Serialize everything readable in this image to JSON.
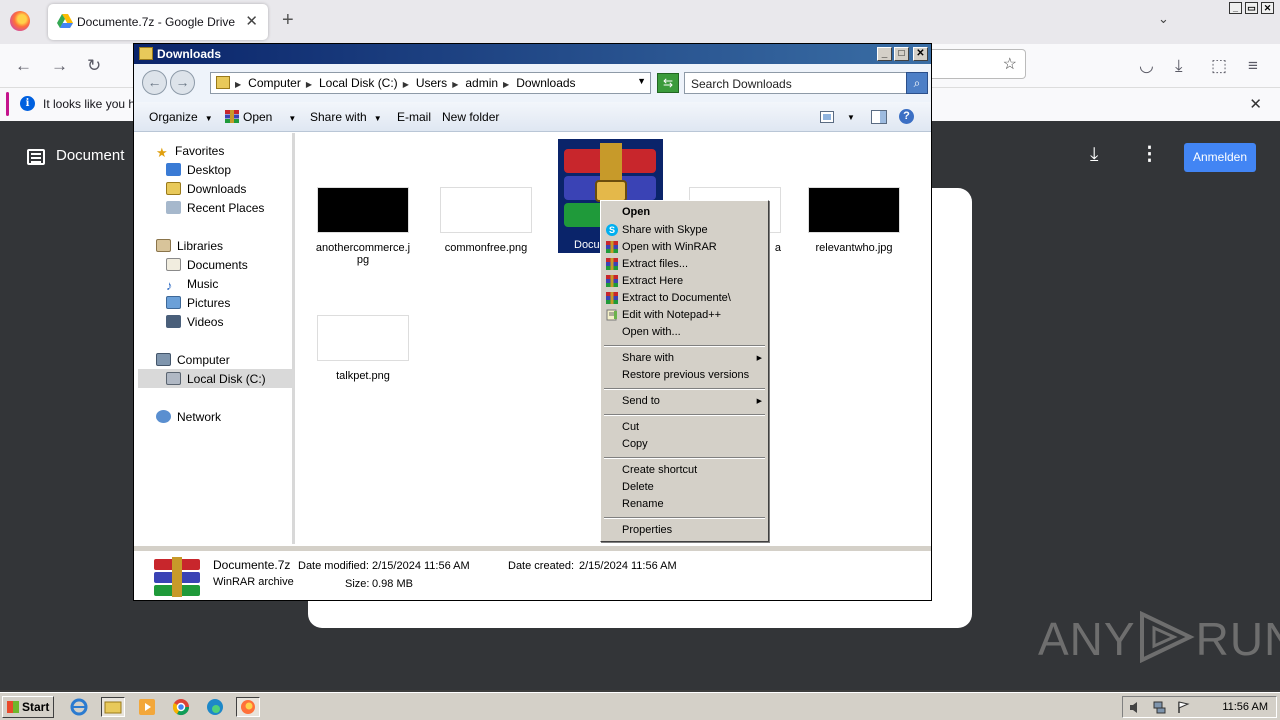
{
  "firefox": {
    "tab_title": "Documente.7z - Google Drive",
    "tab_close": "✕",
    "new_tab": "+",
    "list_tabs": "⌄",
    "back": "←",
    "forward": "→",
    "reload": "↻",
    "bookmark_star": "☆",
    "pocket": "◡",
    "downloads_glyph": "⤓",
    "extensions_glyph": "⬚",
    "menu_glyph": "≡",
    "info_icon": "i",
    "info_text": "It looks like you ha",
    "info_close": "✕",
    "window_controls": [
      "_",
      "▭",
      "✕"
    ]
  },
  "drive": {
    "title": "Document",
    "download_glyph": "⤓",
    "more_glyph": "⋮",
    "signin_label": "Anmelden"
  },
  "watermark": {
    "left": "ANY",
    "right": "RUN"
  },
  "explorer": {
    "title": "Downloads",
    "window_controls": [
      "_",
      "□",
      "✕"
    ],
    "back_glyph": "←",
    "forward_glyph": "→",
    "breadcrumbs": [
      "Computer",
      "Local Disk (C:)",
      "Users",
      "admin",
      "Downloads"
    ],
    "crumb_separator": "▶",
    "address_dropdown": "▼",
    "refresh_glyph": "⇆",
    "search_placeholder": "Search Downloads",
    "search_glyph": "⌕",
    "toolbar": {
      "organize": "Organize",
      "open": "Open",
      "share_with": "Share with",
      "email": "E-mail",
      "new_folder": "New folder",
      "dropdown_arrow": "▼",
      "help": "?"
    },
    "nav": {
      "favorites": "Favorites",
      "desktop": "Desktop",
      "downloads": "Downloads",
      "recent_places": "Recent Places",
      "libraries": "Libraries",
      "documents": "Documents",
      "music": "Music",
      "pictures": "Pictures",
      "videos": "Videos",
      "computer": "Computer",
      "local_disk": "Local Disk (C:)",
      "network": "Network"
    },
    "files": [
      {
        "name": "anothercommerce.jpg",
        "thumb": "dark"
      },
      {
        "name": "commonfree.png",
        "thumb": "light"
      },
      {
        "name": "Documente.7z",
        "thumb": "winrar",
        "label_visible": "Docu"
      },
      {
        "name": "relevantwho.jpg",
        "thumb": "dark"
      },
      {
        "name": "talkpet.png",
        "thumb": "light"
      }
    ],
    "partial_label_fragment": "a",
    "details": {
      "file_name": "Documente.7z",
      "file_type": "WinRAR archive",
      "date_modified_label": "Date modified:",
      "date_modified": "2/15/2024 11:56 AM",
      "date_created_label": "Date created:",
      "date_created": "2/15/2024 11:56 AM",
      "size_label": "Size:",
      "size": "0.98 MB"
    }
  },
  "context_menu": {
    "items": [
      "Open",
      "Share with Skype",
      "Open with WinRAR",
      "Extract files...",
      "Extract Here",
      "Extract to Documente\\",
      "Edit with Notepad++",
      "Open with...",
      "Share with",
      "Restore previous versions",
      "Send to",
      "Cut",
      "Copy",
      "Create shortcut",
      "Delete",
      "Rename",
      "Properties"
    ],
    "submenu_arrow": "▶"
  },
  "taskbar": {
    "start_label": "Start",
    "clock": "11:56 AM"
  },
  "colors": {
    "selection": "#0a246a",
    "title_gradient_start": "#0a246a",
    "title_gradient_end": "#3a6ea5",
    "drive_signin": "#4285f4",
    "classic_gray": "#d4d0c8"
  }
}
